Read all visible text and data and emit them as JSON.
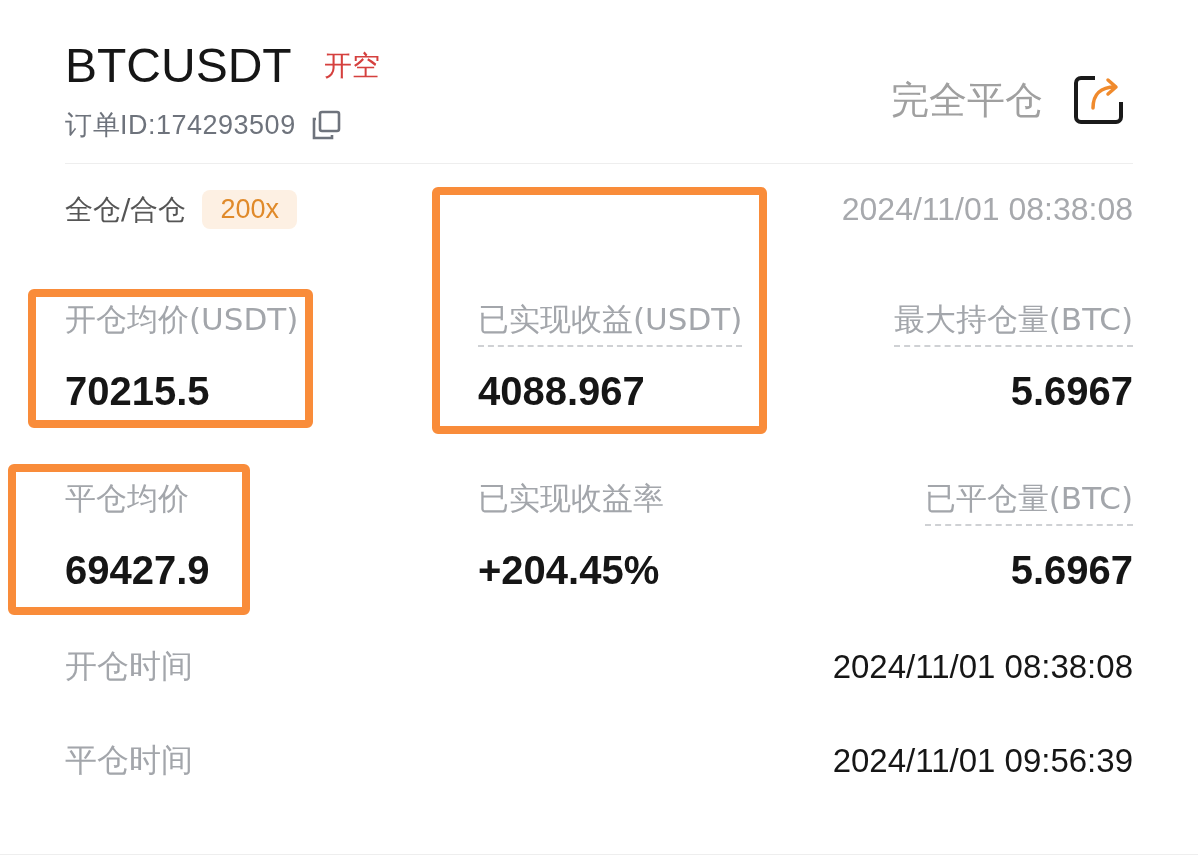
{
  "header": {
    "symbol": "BTCUSDT",
    "side": "开空",
    "order_id": "订单ID:174293509",
    "close_all": "完全平仓"
  },
  "info": {
    "margin_mode": "全仓/合仓",
    "leverage": "200x",
    "time": "2024/11/01 08:38:08"
  },
  "stats": [
    {
      "label": "开仓均价(USDT)",
      "value": "70215.5",
      "dashed": false,
      "highlighted": true
    },
    {
      "label": "已实现收益(USDT)",
      "value": "4088.967",
      "dashed": true,
      "highlighted": true
    },
    {
      "label": "最大持仓量(BTC)",
      "value": "5.6967",
      "dashed": true,
      "highlighted": false
    },
    {
      "label": "平仓均价",
      "value": "69427.9",
      "dashed": false,
      "highlighted": true
    },
    {
      "label": "已实现收益率",
      "value": "+204.45%",
      "dashed": false,
      "highlighted": false
    },
    {
      "label": "已平仓量(BTC)",
      "value": "5.6967",
      "dashed": true,
      "highlighted": false
    }
  ],
  "times": [
    {
      "label": "开仓时间",
      "value": "2024/11/01 08:38:08"
    },
    {
      "label": "平仓时间",
      "value": "2024/11/01 09:56:39"
    }
  ]
}
